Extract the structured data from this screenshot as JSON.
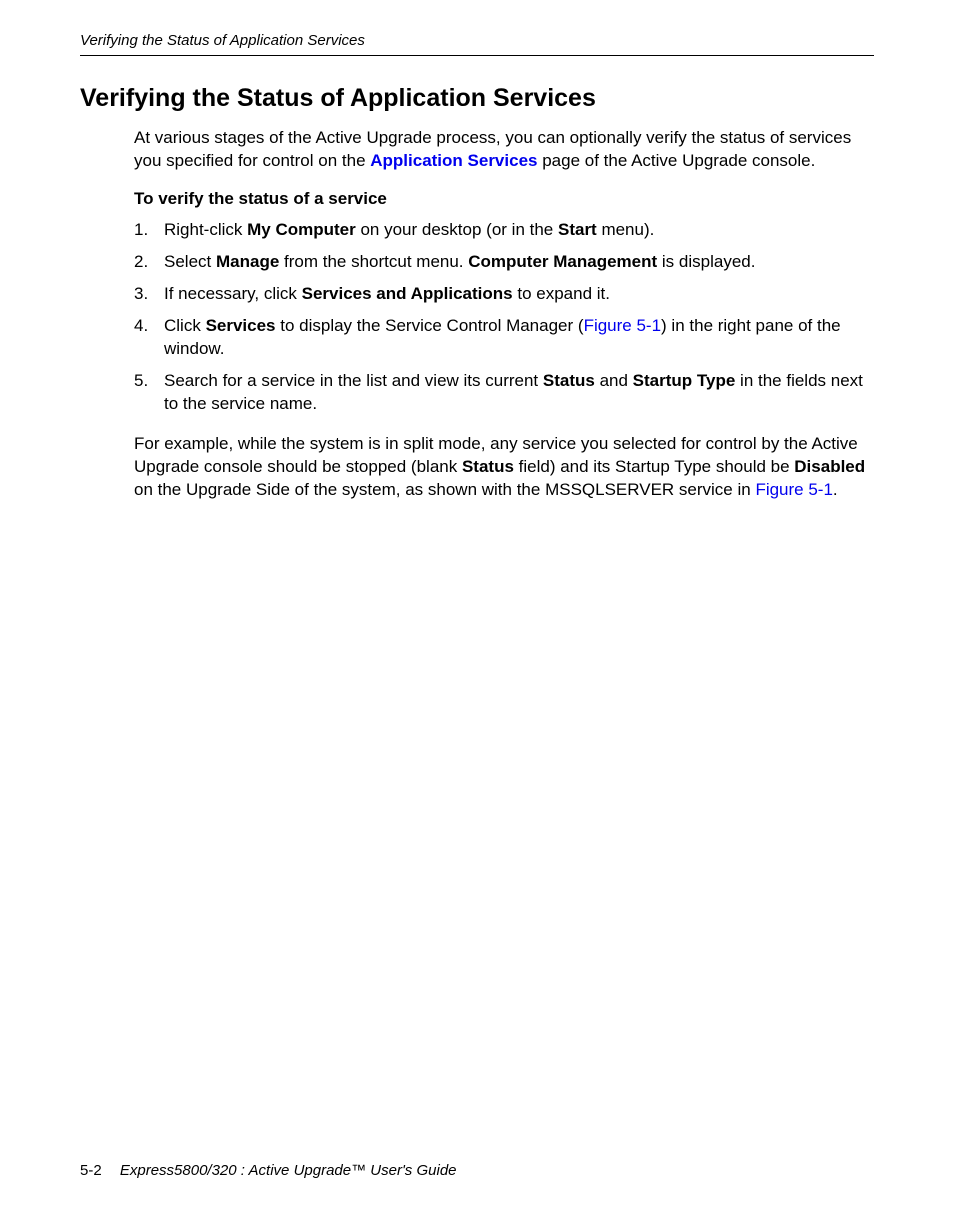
{
  "header": {
    "running_title": "Verifying the Status of Application Services"
  },
  "section": {
    "title": "Verifying the Status of Application Services",
    "intro_pre": "At various stages of the Active Upgrade process, you can optionally verify the status of services you specified for control on the ",
    "intro_link": "Application Services",
    "intro_post": " page of the Active Upgrade console.",
    "subheading": "To verify the status of a service",
    "items": {
      "n1": "1.",
      "i1_pre": "Right-click ",
      "i1_bold1": "My Computer",
      "i1_mid": " on your desktop (or in the ",
      "i1_bold2": "Start",
      "i1_post": " menu).",
      "n2": "2.",
      "i2_pre": "Select ",
      "i2_bold1": "Manage",
      "i2_mid": " from the shortcut menu. ",
      "i2_bold2": "Computer Management",
      "i2_post": " is displayed.",
      "n3": "3.",
      "i3_pre": "If necessary, click ",
      "i3_bold": "Services and Applications",
      "i3_post": " to expand it.",
      "n4": "4.",
      "i4_pre": "Click ",
      "i4_bold": "Services",
      "i4_mid": " to display the Service Control Manager (",
      "i4_link": "Figure 5-1",
      "i4_post": ") in the right pane of the window.",
      "n5": "5.",
      "i5_pre": "Search for a service in the list and view its current ",
      "i5_bold1": "Status",
      "i5_mid": " and ",
      "i5_bold2": "Startup Type",
      "i5_post": " in the fields next to the service name."
    },
    "example_pre": "For example, while the system is in split mode, any service you selected for control by the Active Upgrade console should be stopped (blank ",
    "example_bold1": "Status",
    "example_mid1": " field) and its Startup Type should be ",
    "example_bold2": "Disabled",
    "example_mid2": " on the Upgrade Side of the system, as shown with the MSSQLSERVER service in ",
    "example_link": "Figure 5-1",
    "example_post": "."
  },
  "footer": {
    "page": "5-2",
    "title": "Express5800/320    : Active Upgrade™ User's Guide"
  }
}
